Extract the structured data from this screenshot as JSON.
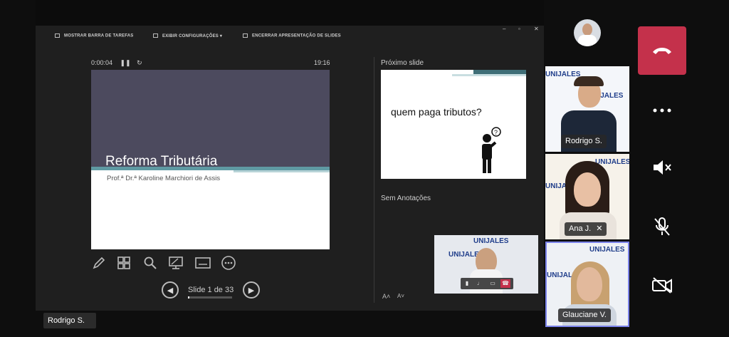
{
  "toolbar": {
    "taskbar_label": "MOSTRAR BARRA DE TAREFAS",
    "settings_label": "EXIBIR CONFIGURAÇÕES",
    "end_label": "ENCERRAR APRESENTAÇÃO DE SLIDES",
    "window_controls": [
      "–",
      "▫",
      "✕"
    ]
  },
  "presenter": {
    "timer": "0:00:04",
    "clock": "19:16",
    "current_slide": {
      "title": "Reforma Tributária",
      "subtitle": "Prof.ª Dr.ª Karoline Marchiori de Assis"
    },
    "slide_counter": "Slide 1 de 33",
    "progress_fraction": 0.03,
    "next_label": "Próximo slide",
    "next_slide_text": "quem paga tributos?",
    "notes_label": "Sem Anotações",
    "tools": [
      "pen-icon",
      "grid-icon",
      "zoom-icon",
      "pointer-icon",
      "subtitles-icon",
      "more-icon"
    ]
  },
  "self_view": {
    "brand": "UNIJALES"
  },
  "presenter_name": "Rodrigo S.",
  "participants": [
    {
      "name": "Rodrigo S.",
      "brand": "UNIJALES"
    },
    {
      "name": "Ana J.",
      "brand": "UNIJALES",
      "muted": true
    },
    {
      "name": "Glauciane V.",
      "brand": "UNIJALES",
      "active": true
    }
  ],
  "colors": {
    "end_call": "#c4314b",
    "slide_header": "#4c4a5e",
    "slide_accent": "#5f9aa3"
  },
  "controls": [
    "end-call",
    "more-options",
    "speaker-muted",
    "mic-muted",
    "camera-off"
  ]
}
